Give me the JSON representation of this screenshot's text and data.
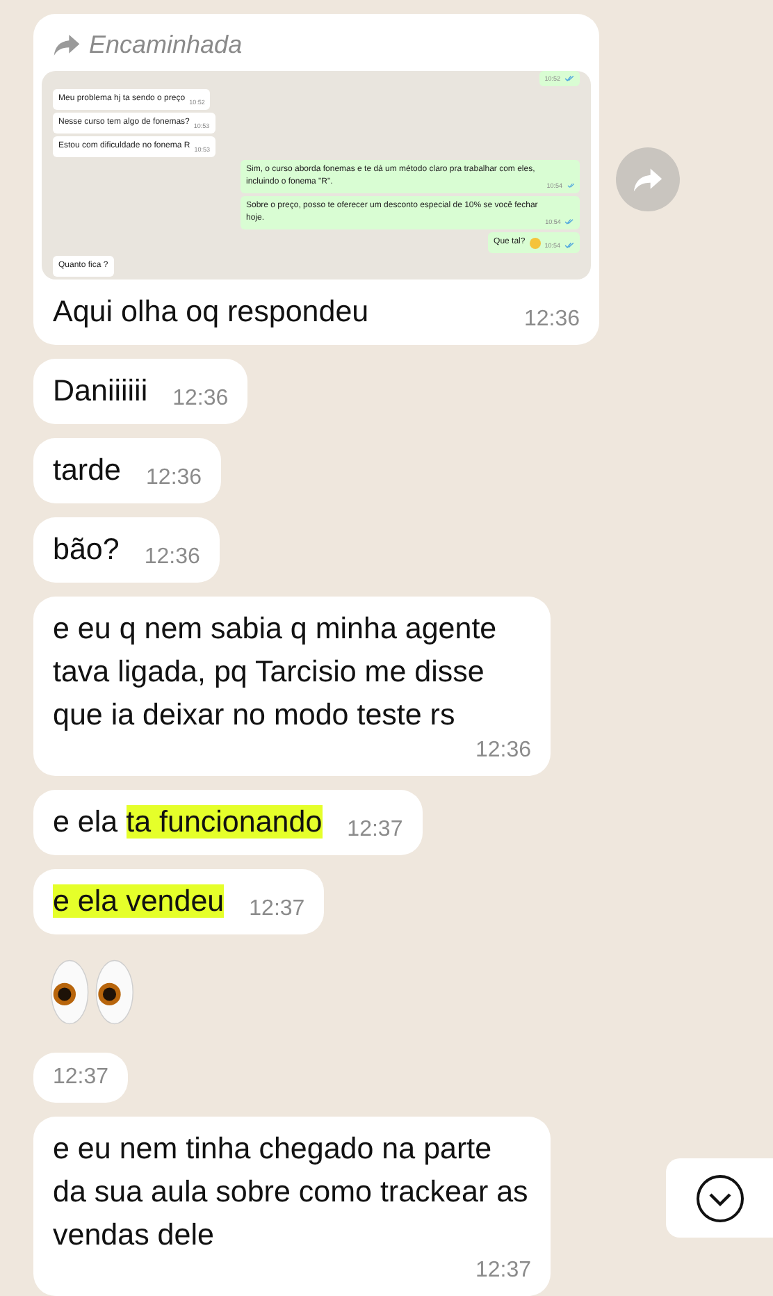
{
  "messages": [
    {
      "kind": "forwarded",
      "forward_label": "Encaminhada",
      "screenshot": [
        {
          "time": "10:52",
          "outgoing": true,
          "read": true
        },
        {
          "text": "Meu problema hj ta sendo o preço",
          "time": "10:52",
          "outgoing": false,
          "read": false
        },
        {
          "text": "Nesse curso tem algo de fonemas?",
          "time": "10:53",
          "outgoing": false,
          "read": false
        },
        {
          "text": "Estou com dificuldade no fonema R",
          "time": "10:53",
          "outgoing": false,
          "read": false
        },
        {
          "text": "Sim, o curso aborda fonemas e te dá um método claro pra trabalhar com eles, incluindo o fonema \"R\".",
          "time": "10:54",
          "outgoing": true,
          "read": true
        },
        {
          "text": "Sobre o preço, posso te oferecer um desconto especial de 10% se você fechar hoje.",
          "time": "10:54",
          "outgoing": true,
          "read": true
        },
        {
          "text": "Que tal?",
          "time": "10:54",
          "outgoing": true,
          "read": true,
          "smiley": true
        },
        {
          "text": "Quanto fica ?",
          "outgoing": false,
          "read": false
        }
      ],
      "parts": [
        {
          "text": "Aqui olha oq respondeu",
          "highlighted": false
        }
      ],
      "time": "12:36"
    },
    {
      "kind": "text",
      "parts": [
        {
          "text": "Daniiiiii",
          "highlighted": false
        }
      ],
      "time": "12:36"
    },
    {
      "kind": "text",
      "parts": [
        {
          "text": "tarde",
          "highlighted": false
        }
      ],
      "time": "12:36"
    },
    {
      "kind": "text",
      "parts": [
        {
          "text": "bão?",
          "highlighted": false
        }
      ],
      "time": "12:36"
    },
    {
      "kind": "text",
      "parts": [
        {
          "text": "e eu q nem sabia q minha agente tava ligada, pq Tarcisio me disse que ia deixar no modo teste rs",
          "highlighted": false
        }
      ],
      "time": "12:36"
    },
    {
      "kind": "text",
      "parts": [
        {
          "text": "e ela",
          "highlighted": false
        },
        {
          "text": "ta funcionando",
          "highlighted": true
        }
      ],
      "time": "12:37"
    },
    {
      "kind": "text",
      "parts": [
        {
          "text": "e ela vendeu",
          "highlighted": true
        }
      ],
      "time": "12:37"
    },
    {
      "kind": "eyes"
    },
    {
      "kind": "time",
      "time": "12:37"
    },
    {
      "kind": "text",
      "parts": [
        {
          "text": "e eu nem tinha chegado na parte da sua aula sobre como trackear as vendas dele",
          "highlighted": false
        }
      ],
      "time": "12:37"
    }
  ]
}
